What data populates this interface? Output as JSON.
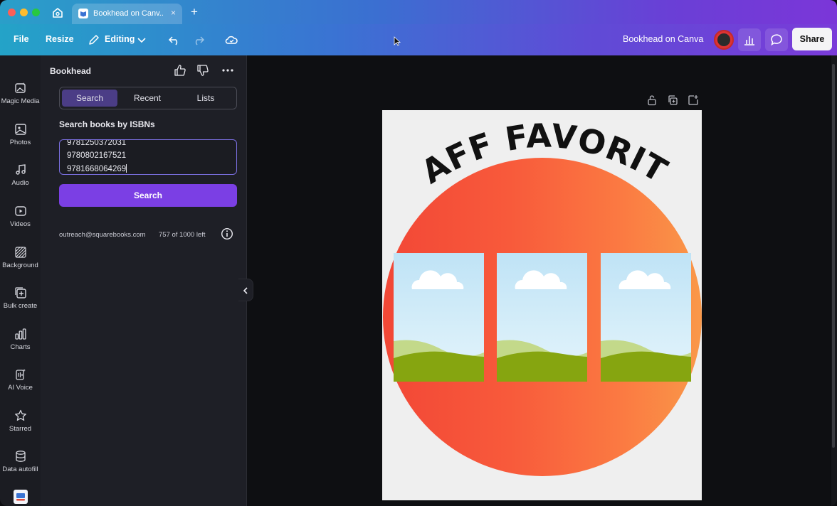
{
  "browser": {
    "tab_title": "Bookhead on Canv...",
    "tab_close": "×",
    "new_tab": "+"
  },
  "toolbar": {
    "file": "File",
    "resize": "Resize",
    "editing": "Editing",
    "doc_title": "Bookhead on Canva",
    "share": "Share"
  },
  "rail": {
    "items": [
      {
        "label": "Magic Media",
        "icon": "magic-media-icon"
      },
      {
        "label": "Photos",
        "icon": "photos-icon"
      },
      {
        "label": "Audio",
        "icon": "audio-icon"
      },
      {
        "label": "Videos",
        "icon": "videos-icon"
      },
      {
        "label": "Background",
        "icon": "background-icon"
      },
      {
        "label": "Bulk create",
        "icon": "bulk-create-icon"
      },
      {
        "label": "Charts",
        "icon": "charts-icon"
      },
      {
        "label": "AI Voice",
        "icon": "ai-voice-icon"
      },
      {
        "label": "Starred",
        "icon": "star-icon"
      },
      {
        "label": "Data autofill",
        "icon": "database-icon"
      }
    ]
  },
  "panel": {
    "title": "Bookhead",
    "tabs": [
      "Search",
      "Recent",
      "Lists"
    ],
    "active_tab": "Search",
    "heading": "Search books by ISBNs",
    "isbns": [
      "9781250372031",
      "9780802167521",
      "9781668064269"
    ],
    "search_button": "Search",
    "email": "outreach@squarebooks.com",
    "usage": "757 of 1000 left"
  },
  "poster": {
    "title": "STAFF FAVORITES",
    "photo_count": 3,
    "colors": {
      "background": "#efefef",
      "circle_start": "#f24736",
      "circle_end": "#fa9849",
      "title": "#111111"
    }
  },
  "colors": {
    "accent": "#7b3fe4",
    "segment_active": "#4b3d86",
    "panel_bg": "#1e1f26",
    "canvas_bg": "#0e0f12"
  }
}
